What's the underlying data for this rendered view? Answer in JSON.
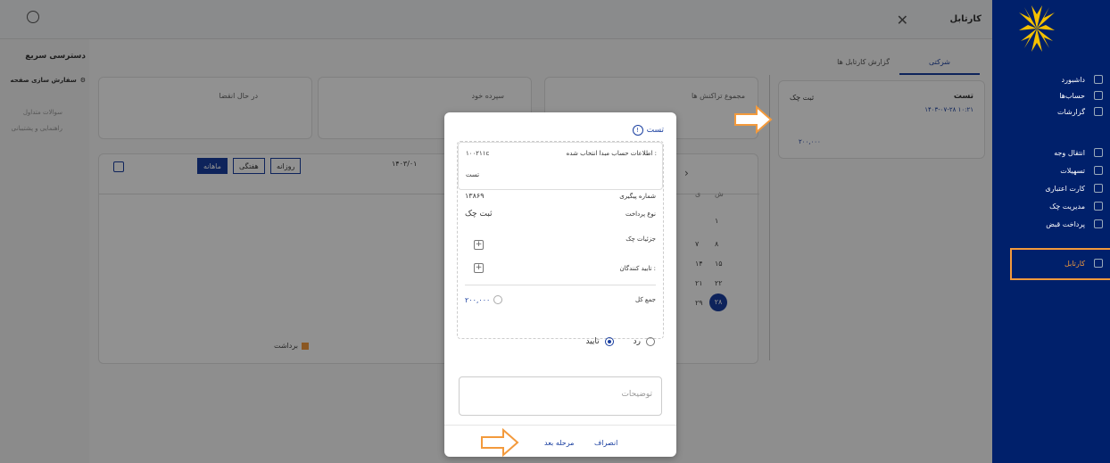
{
  "header": {
    "title": "کارتابل",
    "close_icon": "close-icon",
    "avatar_icon": "user-circle-icon"
  },
  "tabs": {
    "company": "شرکتی",
    "report": "گزارش کارتابل ها"
  },
  "quick_access": {
    "title": "دسترسی سریع",
    "customize": "سفارش سازی صفحه",
    "faq": "سوالات متداول",
    "support": "راهنمایی و پشتیبانی"
  },
  "stats": {
    "total_transactions": "مجموع تراکنش ها",
    "deposit": "سپرده خود",
    "pending": "در حال انقضا"
  },
  "chart": {
    "daily": "روزانه",
    "weekly": "هفتگی",
    "monthly": "ماهانه",
    "date_value": "۱۴۰۳/۰۱",
    "legend": "برداشت",
    "legend_color": "#f39a3c"
  },
  "calendar": {
    "weekday": "ش",
    "weekday2": "ی",
    "days": [
      "۱",
      "۸",
      "۷",
      "۱۵",
      "۱۴",
      "۲۲",
      "۲۱",
      "۲۹",
      "۲۸"
    ]
  },
  "item_card": {
    "title": "تست",
    "badge": "ثبت چک",
    "date": "۱۴۰۳-۰۷-۲۸ ۱۰:۲۱",
    "amount": "۲۰۰,۰۰۰"
  },
  "sidebar": {
    "items": [
      {
        "label": "داشبورد",
        "icon": "dashboard-icon"
      },
      {
        "label": "حساب‌ها",
        "icon": "wallet-icon"
      },
      {
        "label": "گزارشات",
        "icon": "report-icon"
      },
      {
        "label": "انتقال وجه",
        "icon": "transfer-icon"
      },
      {
        "label": "تسهیلات",
        "icon": "loan-icon"
      },
      {
        "label": "کارت اعتباری",
        "icon": "card-icon"
      },
      {
        "label": "مدیریت چک",
        "icon": "cheque-icon"
      },
      {
        "label": "پرداخت قبض",
        "icon": "bill-icon"
      },
      {
        "label": "کارتابل",
        "icon": "cartable-icon"
      }
    ]
  },
  "modal": {
    "title": "تست",
    "source_label": "اطلاعات حساب مبدا انتخاب شده :",
    "source_value": "۱۰۰۲۱۱c",
    "source_name": "تست",
    "tracking_label": "شماره پیگیری",
    "tracking_value": "۱۳۸۶۹",
    "type_label": "نوع پرداخت",
    "type_value": "ثبت چک",
    "cheque_details_label": "جزئیات چک",
    "approvers_label": "تایید کنندگان :",
    "total_label": "جمع کل",
    "total_value": "۲۰۰,۰۰۰",
    "approve": "تایید",
    "reject": "رد",
    "description_placeholder": "توضیحات",
    "cancel": "انصراف",
    "next": "مرحله بعد"
  }
}
